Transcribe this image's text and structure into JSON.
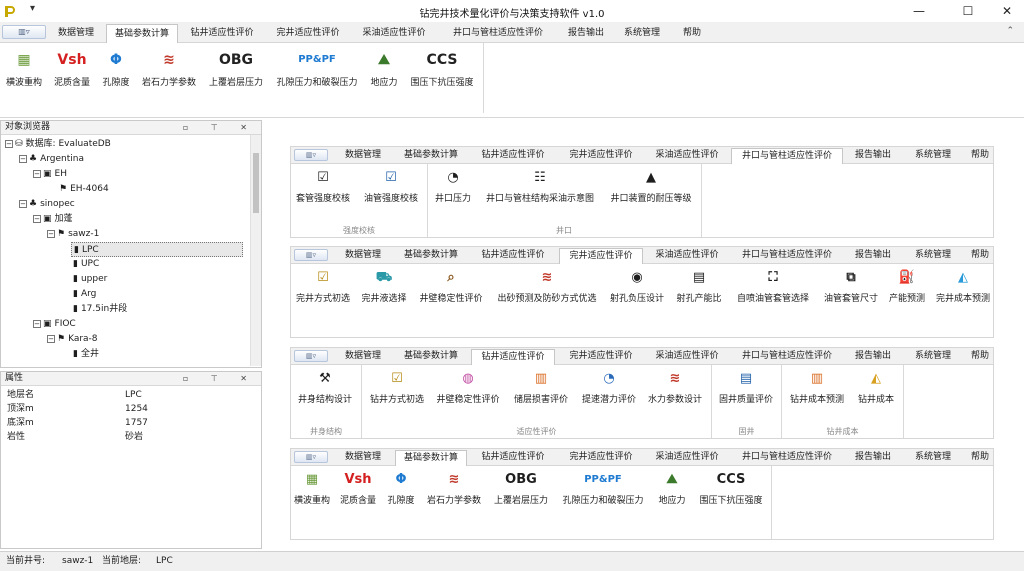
{
  "window": {
    "title": "钻完井技术量化评价与决策支持软件 v1.0",
    "qa_symbol": "▾",
    "min": "—",
    "max": "☐",
    "close": "✕"
  },
  "menu": {
    "app_symbol": "▥▿",
    "collapse_symbol": "⌃",
    "tabs": [
      "数据管理",
      "基础参数计算",
      "钻井适应性评价",
      "完井适应性评价",
      "采油适应性评价",
      "井口与管柱适应性评价",
      "报告输出",
      "系统管理",
      "帮助"
    ]
  },
  "ribbon_main": {
    "buttons": [
      {
        "icon": "▦",
        "icon_name": "shear-wave-icon",
        "label": "横波重构"
      },
      {
        "icon": "Vsh",
        "icon_name": "vsh-icon",
        "label": "泥质含量"
      },
      {
        "icon": "Φ",
        "icon_name": "phi-icon",
        "label": "孔隙度"
      },
      {
        "icon": "≋",
        "icon_name": "rock-mechanics-icon",
        "label": "岩石力学参数"
      },
      {
        "icon": "OBG",
        "icon_name": "obg-icon",
        "label": "上覆岩层压力"
      },
      {
        "icon": "PP&PF",
        "icon_name": "pp-pf-icon",
        "label": "孔隙压力和破裂压力"
      },
      {
        "icon": "⛰",
        "icon_name": "geostress-icon",
        "label": "地应力"
      },
      {
        "icon": "CCS",
        "icon_name": "ccs-icon",
        "label": "围压下抗压强度"
      }
    ]
  },
  "explorer": {
    "title": "对象浏览器",
    "pane_buttons": "▫ ⊤ ✕",
    "nodes": [
      {
        "label": "数据库: EvaluateDB",
        "icon": "⛁",
        "exp": "−"
      },
      {
        "label": "Argentina",
        "icon": "♣",
        "exp": "−"
      },
      {
        "label": "EH",
        "icon": "▣",
        "exp": "−"
      },
      {
        "label": "EH-4064",
        "icon": "⚑",
        "exp": ""
      },
      {
        "label": "sinopec",
        "icon": "♣",
        "exp": "−"
      },
      {
        "label": "加蓬",
        "icon": "▣",
        "exp": "−"
      },
      {
        "label": "sawz-1",
        "icon": "⚑",
        "exp": "−"
      },
      {
        "label": "LPC",
        "icon": "▮",
        "exp": ""
      },
      {
        "label": "UPC",
        "icon": "▮",
        "exp": ""
      },
      {
        "label": "upper",
        "icon": "▮",
        "exp": ""
      },
      {
        "label": "Arg",
        "icon": "▮",
        "exp": ""
      },
      {
        "label": "17.5in井段",
        "icon": "▮",
        "exp": ""
      },
      {
        "label": "FIOC",
        "icon": "▣",
        "exp": "−"
      },
      {
        "label": "Kara-8",
        "icon": "⚑",
        "exp": "−"
      },
      {
        "label": "全井",
        "icon": "▮",
        "exp": ""
      }
    ]
  },
  "properties": {
    "title": "属性",
    "pane_buttons": "▫ ⊤ ✕",
    "rows": [
      {
        "key": "地层名",
        "value": "LPC"
      },
      {
        "key": "顶深m",
        "value": "1254"
      },
      {
        "key": "底深m",
        "value": "1757"
      },
      {
        "key": "岩性",
        "value": "砂岩"
      }
    ]
  },
  "float_wellhead": {
    "active": "井口与管柱适应性评价",
    "buttons": [
      {
        "icon": "☑",
        "icon_name": "casing-check-icon",
        "label": "套管强度校核"
      },
      {
        "icon": "☑",
        "icon_name": "tubing-check-icon",
        "label": "油管强度校核"
      },
      {
        "icon": "◔",
        "icon_name": "gauge-icon",
        "label": "井口压力"
      },
      {
        "icon": "☷",
        "icon_name": "wellhead-diagram-icon",
        "label": "井口与管柱结构采油示意图"
      },
      {
        "icon": "▲",
        "icon_name": "pressure-grade-icon",
        "label": "井口装置的耐压等级"
      }
    ],
    "groups": [
      "强度校核",
      "井口"
    ]
  },
  "float_completion": {
    "active": "完井适应性评价",
    "buttons": [
      {
        "icon": "☑",
        "icon_name": "completion-select-icon",
        "label": "完井方式初选"
      },
      {
        "icon": "⛟",
        "icon_name": "fluid-select-icon",
        "label": "完井液选择"
      },
      {
        "icon": "⌕",
        "icon_name": "wellbore-stability-icon",
        "label": "井壁稳定性评价"
      },
      {
        "icon": "≋",
        "icon_name": "sand-control-icon",
        "label": "出砂预测及防砂方式优选"
      },
      {
        "icon": "◉",
        "icon_name": "perforation-icon",
        "label": "射孔负压设计"
      },
      {
        "icon": "▤",
        "icon_name": "productivity-icon",
        "label": "射孔产能比"
      },
      {
        "icon": "⛶",
        "icon_name": "tubing-select-icon",
        "label": "自喷油管套管选择"
      },
      {
        "icon": "⧉",
        "icon_name": "casing-size-icon",
        "label": "油管套管尺寸"
      },
      {
        "icon": "⛽",
        "icon_name": "capacity-forecast-icon",
        "label": "产能预测"
      },
      {
        "icon": "◭",
        "icon_name": "completion-cost-icon",
        "label": "完井成本预测"
      }
    ]
  },
  "float_drilling": {
    "active": "钻井适应性评价",
    "buttons": [
      {
        "icon": "⚒",
        "icon_name": "well-structure-icon",
        "label": "井身结构设计"
      },
      {
        "icon": "☑",
        "icon_name": "drilling-select-icon",
        "label": "钻井方式初选"
      },
      {
        "icon": "◍",
        "icon_name": "wellbore-eval-icon",
        "label": "井壁稳定性评价"
      },
      {
        "icon": "▥",
        "icon_name": "reservoir-damage-icon",
        "label": "储层损害评价"
      },
      {
        "icon": "◔",
        "icon_name": "rop-icon",
        "label": "提速潜力评价"
      },
      {
        "icon": "≋",
        "icon_name": "hydraulic-icon",
        "label": "水力参数设计"
      },
      {
        "icon": "▤",
        "icon_name": "cement-quality-icon",
        "label": "固井质量评价"
      },
      {
        "icon": "▥",
        "icon_name": "drilling-cost-forecast-icon",
        "label": "钻井成本预测"
      },
      {
        "icon": "◭",
        "icon_name": "drilling-cost-icon",
        "label": "钻井成本"
      }
    ],
    "groups": [
      "井身结构",
      "适应性评价",
      "固井",
      "钻井成本"
    ]
  },
  "float_basic": {
    "active": "基础参数计算"
  },
  "status": {
    "well_label": "当前井号:",
    "well": "sawz-1",
    "layer_label": "当前地层:",
    "layer": "LPC"
  }
}
